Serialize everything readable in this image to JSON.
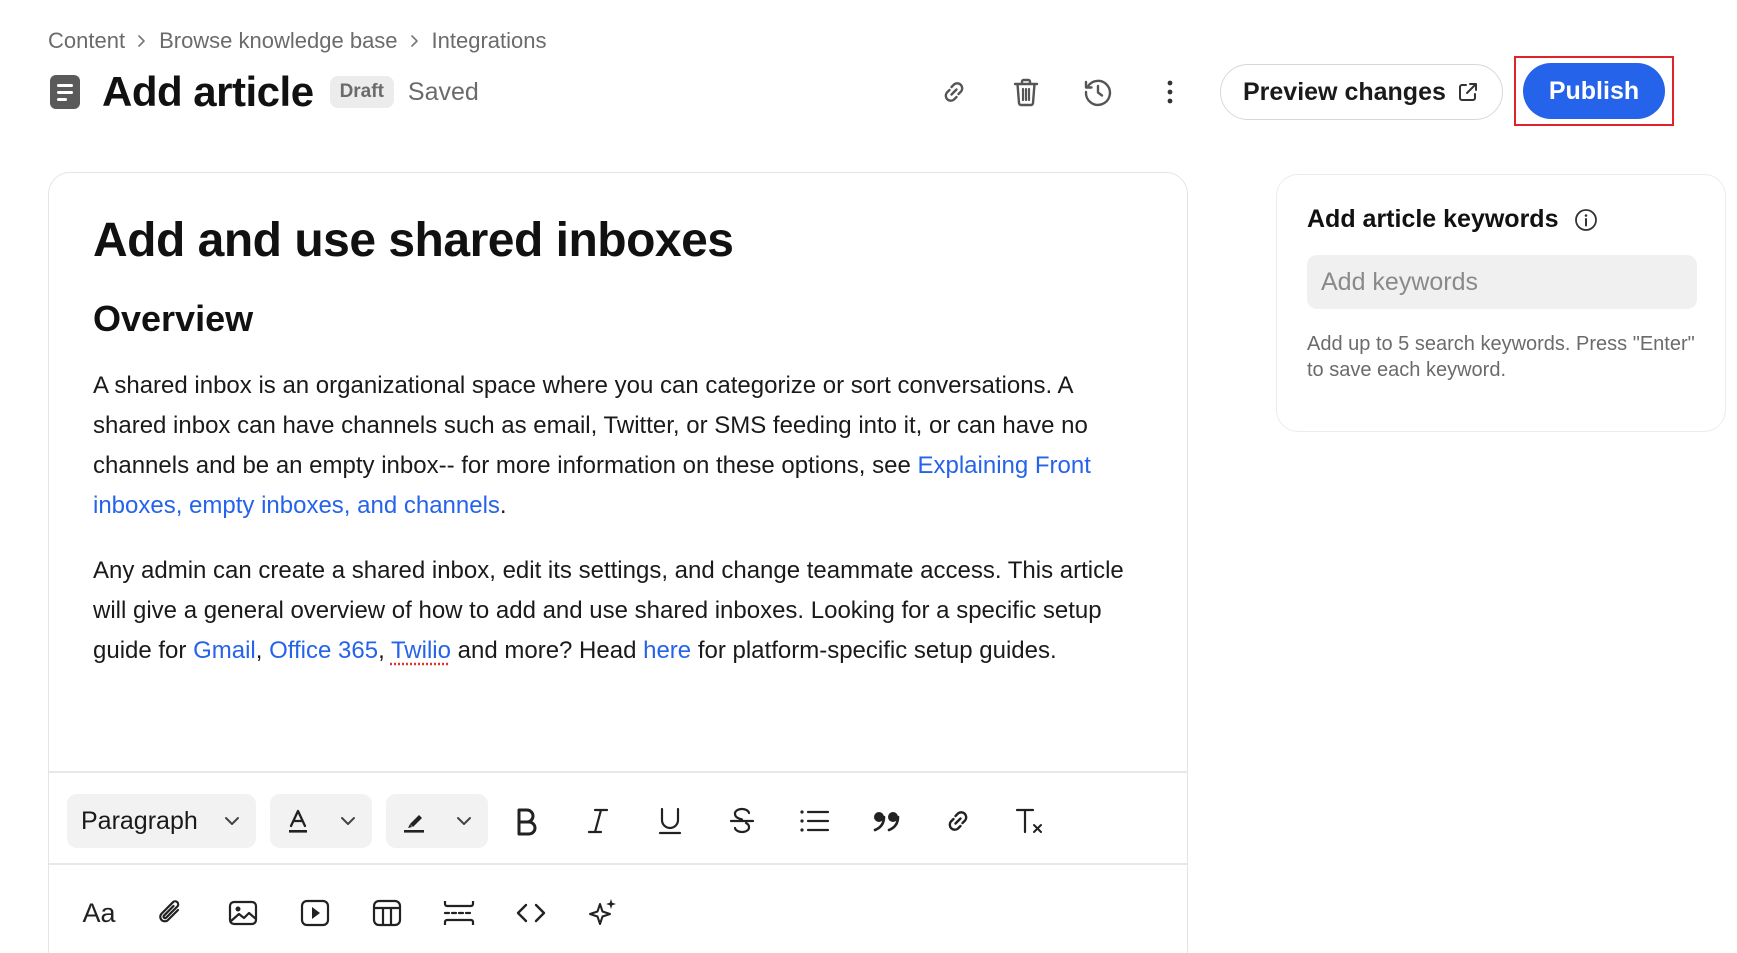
{
  "breadcrumb": {
    "items": [
      "Content",
      "Browse knowledge base",
      "Integrations"
    ]
  },
  "header": {
    "title": "Add article",
    "status_badge": "Draft",
    "saved_label": "Saved",
    "icons": [
      "link-icon",
      "trash-icon",
      "history-icon",
      "more-vertical-icon"
    ],
    "preview_label": "Preview changes",
    "publish_label": "Publish"
  },
  "colors": {
    "accent": "#2563eb",
    "highlight_border": "#e0222a",
    "muted_text": "#6b6b6b"
  },
  "article": {
    "title": "Add and use shared inboxes",
    "section_heading": "Overview",
    "p1_before_link": "A shared inbox is an organizational space where you can categorize or sort conversations. A shared inbox can have channels such as email, Twitter, or SMS feeding into it, or can have no channels and be an empty inbox-- for more information on these options, see ",
    "p1_link": "Explaining Front inboxes, empty inboxes, and channels",
    "p1_after_link": ".",
    "p2_intro": "Any admin can create a shared inbox, edit its settings, and change teammate access. This article will give a general overview of how to add and use shared inboxes. Looking for a specific setup guide for ",
    "p2_link_gmail": "Gmail",
    "p2_comma1": ", ",
    "p2_link_office": "Office 365",
    "p2_comma2": ", ",
    "p2_link_twilio": "Twilio",
    "p2_mid": " and more? Head ",
    "p2_link_here": "here",
    "p2_end": " for platform-specific setup guides."
  },
  "toolbar": {
    "block_style": "Paragraph",
    "row1_icons": [
      "bold-icon",
      "italic-icon",
      "underline-icon",
      "strikethrough-icon",
      "bulleted-list-icon",
      "quote-icon",
      "link-icon",
      "clear-format-icon"
    ],
    "font_size_label": "Aa",
    "row2_icons": [
      "attachment-icon",
      "image-icon",
      "video-icon",
      "table-icon",
      "divider-icon",
      "code-icon",
      "ai-sparkle-icon"
    ]
  },
  "keywords": {
    "title": "Add article keywords",
    "placeholder": "Add keywords",
    "value": "",
    "help": "Add up to 5 search keywords. Press \"Enter\" to save each keyword."
  }
}
